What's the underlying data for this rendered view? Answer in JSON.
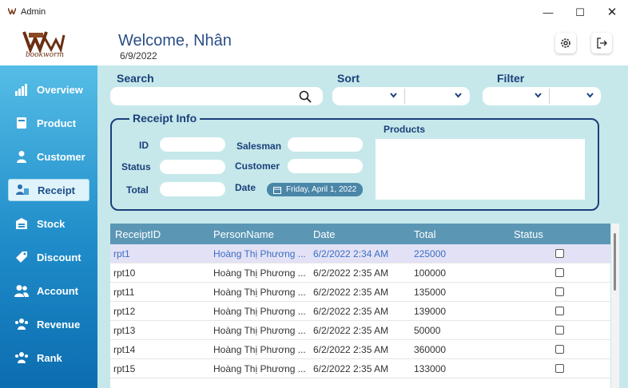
{
  "window": {
    "title": "Admin",
    "controls": {
      "minimize": "—",
      "maximize": "☐",
      "close": "✕"
    }
  },
  "header": {
    "brand": "bookworm",
    "welcome": "Welcome, Nhân",
    "date": "6/9/2022",
    "settings_icon": "gear-icon",
    "logout_icon": "logout-icon"
  },
  "sidebar": {
    "items": [
      {
        "label": "Overview",
        "icon": "bar-chart-icon"
      },
      {
        "label": "Product",
        "icon": "book-icon"
      },
      {
        "label": "Customer",
        "icon": "person-icon"
      },
      {
        "label": "Receipt",
        "icon": "receipt-icon",
        "active": true
      },
      {
        "label": "Stock",
        "icon": "warehouse-icon"
      },
      {
        "label": "Discount",
        "icon": "tag-icon"
      },
      {
        "label": "Account",
        "icon": "users-icon"
      },
      {
        "label": "Revenue",
        "icon": "group-icon"
      },
      {
        "label": "Rank",
        "icon": "group-icon"
      }
    ]
  },
  "toolbar": {
    "search_label": "Search",
    "search_value": "",
    "sort_label": "Sort",
    "filter_label": "Filter"
  },
  "receipt_info": {
    "title": "Receipt Info",
    "id_label": "ID",
    "status_label": "Status",
    "total_label": "Total",
    "salesman_label": "Salesman",
    "customer_label": "Customer",
    "date_label": "Date",
    "date_value": "Friday, April 1, 2022",
    "products_label": "Products"
  },
  "table": {
    "columns": [
      "ReceiptID",
      "PersonName",
      "Date",
      "Total",
      "Status"
    ],
    "rows": [
      {
        "id": "rpt1",
        "person": "Hoàng Thị Phương ...",
        "date": "6/2/2022 2:34 AM",
        "total": "225000",
        "status": false,
        "selected": true
      },
      {
        "id": "rpt10",
        "person": "Hoàng Thị Phương ...",
        "date": "6/2/2022 2:35 AM",
        "total": "100000",
        "status": false
      },
      {
        "id": "rpt11",
        "person": "Hoàng Thị Phương ...",
        "date": "6/2/2022 2:35 AM",
        "total": "135000",
        "status": false
      },
      {
        "id": "rpt12",
        "person": "Hoàng Thị Phương ...",
        "date": "6/2/2022 2:35 AM",
        "total": "139000",
        "status": false
      },
      {
        "id": "rpt13",
        "person": "Hoàng Thị Phương ...",
        "date": "6/2/2022 2:35 AM",
        "total": "50000",
        "status": false
      },
      {
        "id": "rpt14",
        "person": "Hoàng Thị Phương ...",
        "date": "6/2/2022 2:35 AM",
        "total": "360000",
        "status": false
      },
      {
        "id": "rpt15",
        "person": "Hoàng Thị Phương ...",
        "date": "6/2/2022 2:35 AM",
        "total": "133000",
        "status": false
      }
    ]
  },
  "colors": {
    "accent": "#1b3f7a",
    "panel_bg": "#c6e8ea",
    "table_header": "#5b97b5",
    "sidebar_top": "#55bde6",
    "sidebar_bottom": "#0c6db0",
    "selected_row": "#e3e1f5"
  }
}
